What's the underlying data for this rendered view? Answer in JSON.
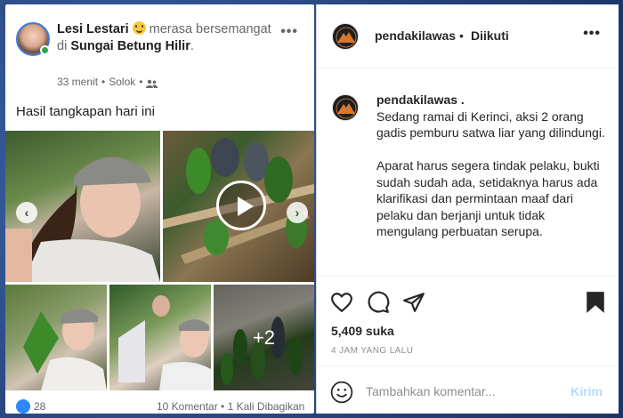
{
  "facebook": {
    "author": "Lesi Lestari",
    "feeling_prefix": "merasa",
    "feeling_text": "bersemangat di",
    "place": "Sungai Betung Hilir",
    "place_suffix": ".",
    "time_ago": "33 menit",
    "location": "Solok",
    "caption": "Hasil tangkapan hari ini",
    "more_photos": "+2",
    "like_count": "28",
    "stats": "10 Komentar • 1 Kali Dibagikan"
  },
  "instagram": {
    "username": "pendakilawas",
    "follow_status": "Diikuti",
    "caption_username": "pendakilawas .",
    "caption_text": "Sedang ramai di Kerinci, aksi 2 orang gadis pemburu satwa liar yang dilindungi.\n\nAparat harus segera tindak pelaku, bukti sudah sudah ada, setidaknya harus ada klarifikasi dan permintaan maaf dari pelaku dan berjanji untuk tidak mengulang perbuatan serupa.",
    "likes": "5,409 suka",
    "time": "4 JAM YANG LALU",
    "comment_placeholder": "Tambahkan komentar...",
    "post_label": "Kirim"
  },
  "colors": {
    "facebook_blue": "#2d88ff",
    "instagram_link": "#b3dbff",
    "online_green": "#31a24c"
  }
}
